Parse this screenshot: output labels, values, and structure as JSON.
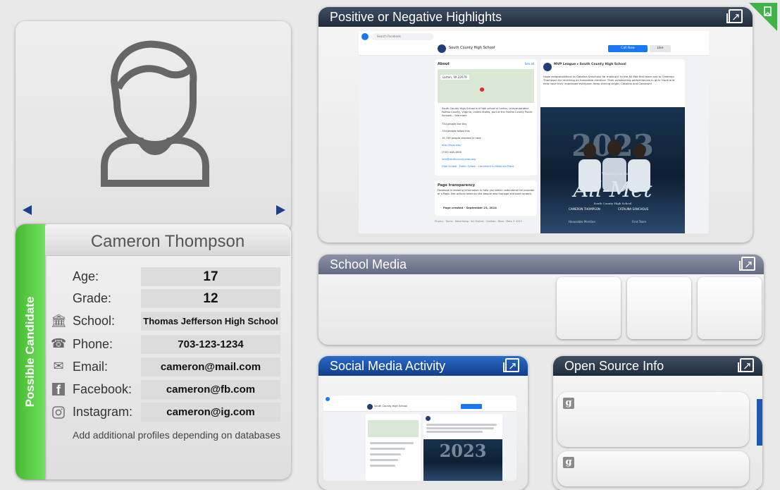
{
  "profile": {
    "name": "Cameron Thompson",
    "status_label": "Possible Candidate",
    "fields": [
      {
        "label": "Age:",
        "value": "17"
      },
      {
        "label": "Grade:",
        "value": "12"
      },
      {
        "label": "School:",
        "value": "Thomas Jefferson High School"
      },
      {
        "label": "Phone:",
        "value": "703-123-1234"
      },
      {
        "label": "Email:",
        "value": "cameron@mail.com"
      },
      {
        "label": "Facebook:",
        "value": "cameron@fb.com"
      },
      {
        "label": "Instagram:",
        "value": "cameron@ig.com"
      }
    ],
    "note": "Add additional profiles depending on databases"
  },
  "panels": {
    "highlights_title": "Positive or Negative Highlights",
    "school_media_title": "School Media",
    "social_title": "Social Media Activity",
    "osint_title": "Open Source Info"
  },
  "fb": {
    "search_placeholder": "Search Facebook",
    "page_name": "South County High School",
    "call_btn": "Call Now",
    "like_btn": "Like",
    "about": "About",
    "see_all": "See all",
    "location": "Lorton, VA 22079",
    "desc": "South County High School is a high school in Lorton, unincorporated Fairfax County, Virginia, United States, part of the Fairfax County Public Schools... See more",
    "likes": "734 people like this",
    "follows": "734 people follow this",
    "checkins": "15,749 people checked in here",
    "site": "http://fcps.edu/",
    "phone": "(703) 446-1600",
    "email": "info@southcountyceos.org",
    "category": "High School · Public School · Landmark & Historical Place",
    "transparency": "Page transparency",
    "transparency_text": "Facebook is showing information to help you better understand the purpose of a Page. See actions taken by the people who manage and post content.",
    "created": "Page created - September 23, 2014",
    "footer": "Privacy · Terms · Advertising · Ad Choices · Cookies · More · Meta © 2023",
    "post_author": "MVP League",
    "post_page": "South County High School",
    "post_text": "Huge congratulations to Catalina Sanchous for making it to the All Met first team and to Cameron Thompson for receiving an honorable mention! Their outstanding performances in girls' track and field have truly impressed everyone. Keep shining bright, Catalina and Cameron!",
    "poster_year": "2023",
    "poster_title": "All-Met",
    "poster_sub": "The Washington Post",
    "poster_school": "South County High School",
    "poster_names": [
      "CAMERON THOMPSON",
      "CATALINA SANCHOUS"
    ],
    "poster_tags": [
      "Honorable Mention",
      "First Team"
    ]
  },
  "icons": {
    "school": "bank-building-icon",
    "phone": "phone-card-icon",
    "email": "envelope-icon",
    "facebook": "facebook-icon",
    "instagram": "instagram-icon",
    "expand": "expand-icon",
    "bookmark": "bookmark-icon",
    "google": "google-icon"
  }
}
